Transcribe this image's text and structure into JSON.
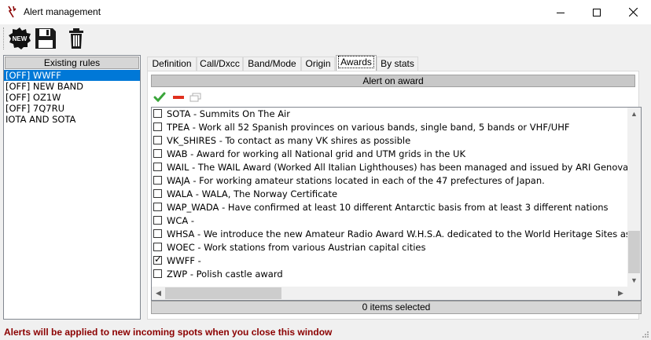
{
  "window": {
    "title": "Alert management"
  },
  "toolbar": {
    "new_label": "NEW"
  },
  "rules": {
    "header": "Existing rules",
    "items": [
      "[OFF] WWFF",
      "[OFF] NEW BAND",
      "[OFF] OZ1W",
      "[OFF] 7Q7RU",
      "IOTA AND SOTA"
    ],
    "selected_index": 0
  },
  "tabs": [
    "Definition",
    "Call/Dxcc",
    "Band/Mode",
    "Origin",
    "Awards",
    "By stats"
  ],
  "active_tab": "Awards",
  "awards": {
    "header": "Alert on award",
    "items": [
      {
        "label": "SOTA - Summits On The Air",
        "checked": false
      },
      {
        "label": "TPEA - Work all 52 Spanish provinces on various bands, single band, 5 bands or VHF/UHF",
        "checked": false
      },
      {
        "label": "VK_SHIRES - To contact as many VK shires as possible",
        "checked": false
      },
      {
        "label": "WAB - Award for working all National grid and UTM grids in the UK",
        "checked": false
      },
      {
        "label": "WAIL - The WAIL Award (Worked All Italian Lighthouses) has been managed and issued by ARI Genova Club",
        "checked": false
      },
      {
        "label": "WAJA - For working amateur stations located in each of the 47 prefectures of Japan.",
        "checked": false
      },
      {
        "label": "WALA - WALA, The Norway Certificate",
        "checked": false
      },
      {
        "label": "WAP_WADA - Have confirmed at least 10 different Antarctic basis from at least 3 different nations",
        "checked": false
      },
      {
        "label": "WCA -",
        "checked": false
      },
      {
        "label": "WHSA - We introduce the new Amateur Radio Award W.H.S.A. dedicated to the World Heritage Sites as listed",
        "checked": false
      },
      {
        "label": "WOEC - Work stations from various Austrian capital cities",
        "checked": false
      },
      {
        "label": "WWFF -",
        "checked": true
      },
      {
        "label": "ZWP - Polish castle award",
        "checked": false
      }
    ],
    "status": "0 items selected"
  },
  "footer": {
    "message": "Alerts will be applied to new incoming spots when you close this window"
  },
  "colors": {
    "selection": "#0078d7",
    "footer_text": "#8b0000",
    "check_green": "#3aa53a",
    "minus_red": "#e0301e"
  }
}
